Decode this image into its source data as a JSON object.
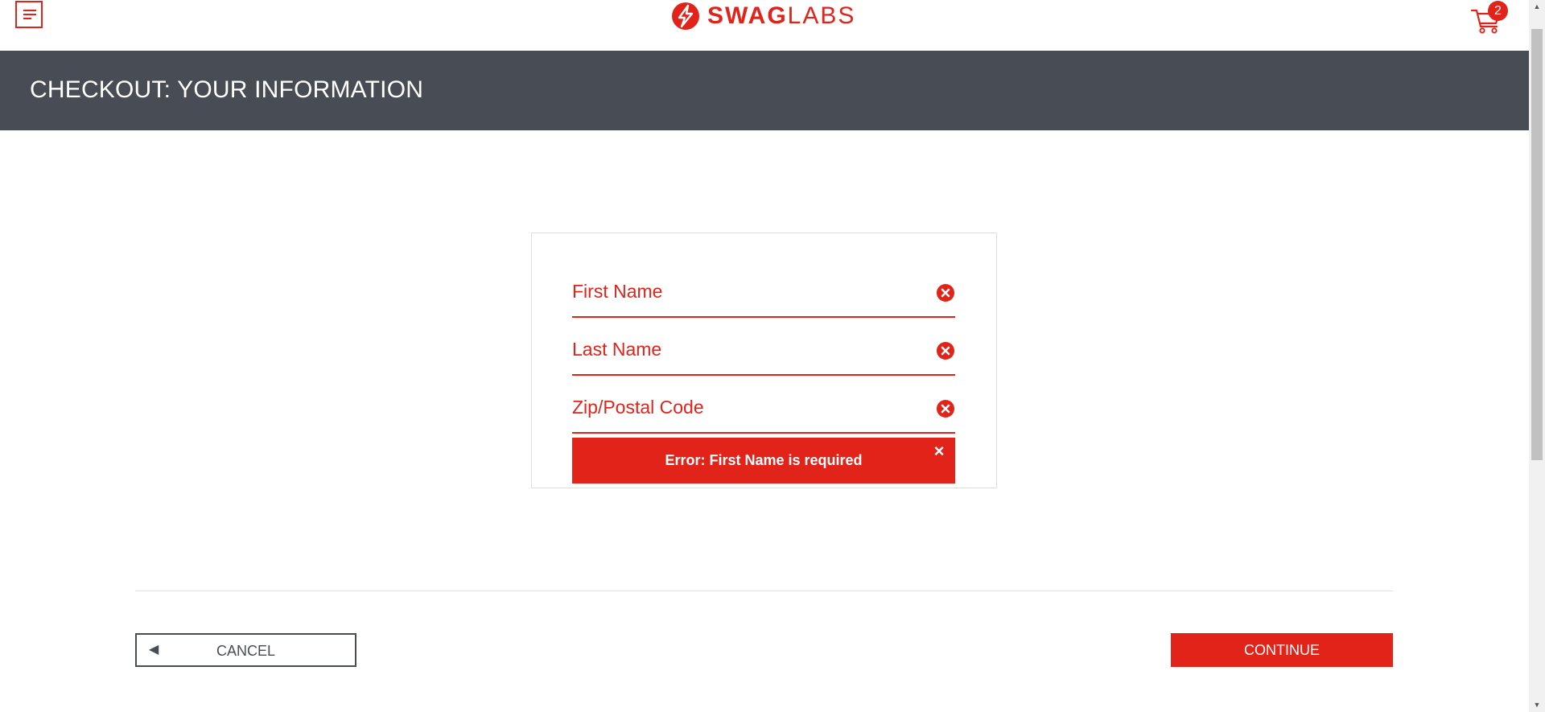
{
  "header": {
    "menu_icon": "hamburger-menu-icon",
    "logo": {
      "icon": "bolt-logo-icon",
      "text_bold": "SWAG",
      "text_light": "LABS"
    },
    "cart": {
      "icon": "shopping-cart-icon",
      "count": "2"
    }
  },
  "page": {
    "title": "CHECKOUT: YOUR INFORMATION"
  },
  "form": {
    "fields": [
      {
        "placeholder": "First Name",
        "value": "",
        "error_icon": "error-x-circle-icon"
      },
      {
        "placeholder": "Last Name",
        "value": "",
        "error_icon": "error-x-circle-icon"
      },
      {
        "placeholder": "Zip/Postal Code",
        "value": "",
        "error_icon": "error-x-circle-icon"
      }
    ],
    "error": {
      "message": "Error: First Name is required",
      "close_icon": "close-icon",
      "close_glyph": "×"
    }
  },
  "actions": {
    "cancel": {
      "arrow": "◀",
      "label": "CANCEL"
    },
    "continue": {
      "label": "CONTINUE"
    }
  },
  "scrollbar": {
    "up_glyph": "▲",
    "down_glyph": "▼"
  },
  "colors": {
    "accent": "#e2231a",
    "header_band": "#484c55",
    "cancel_border": "#474c55"
  }
}
